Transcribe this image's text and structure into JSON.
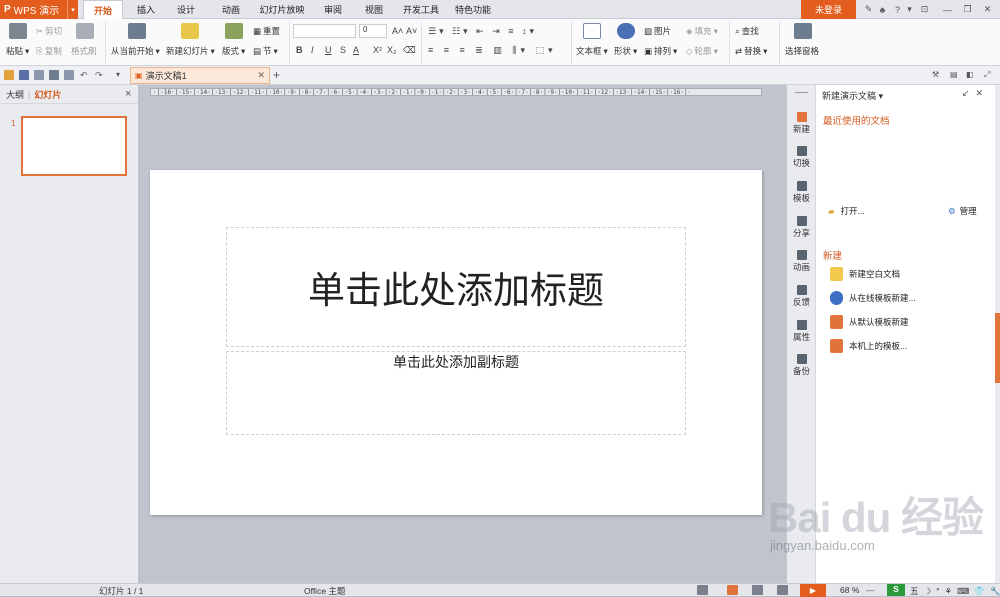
{
  "app": {
    "name": "WPS 演示",
    "drop_icon": "chevron-down-icon",
    "brand_color": "#e25d1e"
  },
  "ribbon_tabs": [
    {
      "label": "开始",
      "active": true
    },
    {
      "label": "插入"
    },
    {
      "label": "设计"
    },
    {
      "label": "动画"
    },
    {
      "label": "幻灯片放映"
    },
    {
      "label": "审阅"
    },
    {
      "label": "视图"
    },
    {
      "label": "开发工具"
    },
    {
      "label": "特色功能"
    }
  ],
  "login": {
    "label": "未登录"
  },
  "titlebar_help": "?",
  "ribbon": {
    "paste": "粘贴",
    "cut": "剪切",
    "copy": "复制",
    "format_painter": "格式刷",
    "from_current": "从当前开始",
    "new_slide": "新建幻灯片",
    "layout": "版式",
    "reset": "重置",
    "section": "节",
    "font_size": "0",
    "text_box": "文本框",
    "shape": "形状",
    "picture": "图片",
    "arrange": "排列",
    "fill": "填充",
    "outline": "轮廓",
    "find": "查找",
    "replace": "替换",
    "selection_pane": "选择窗格"
  },
  "doc_tab": {
    "title": "演示文稿1",
    "add": "+"
  },
  "left_panel": {
    "outline_tab": "大纲",
    "slides_tab": "幻灯片",
    "close": "×",
    "slide_number": "1"
  },
  "ruler_text": "·|·16·|·15·|·14·|·13·|·12·|·11·|·10·|·9·|·8·|·7·|·6·|·5·|·4·|·3·|·2·|·1·|·0·|·1·|·2·|·3·|·4·|·5·|·6·|·7·|·8·|·9·|·10·|·11·|·12·|·13·|·14·|·15·|·16·|·",
  "slide": {
    "title_placeholder": "单击此处添加标题",
    "subtitle_placeholder": "单击此处添加副标题"
  },
  "right_icons": [
    {
      "label": "新建",
      "icon": "new-doc-icon",
      "active": true
    },
    {
      "label": "切换",
      "icon": "switch-icon"
    },
    {
      "label": "模板",
      "icon": "template-icon"
    },
    {
      "label": "分享",
      "icon": "share-icon"
    },
    {
      "label": "动画",
      "icon": "animation-icon"
    },
    {
      "label": "反馈",
      "icon": "feedback-icon"
    },
    {
      "label": "属性",
      "icon": "properties-icon"
    },
    {
      "label": "备份",
      "icon": "backup-icon"
    }
  ],
  "task_pane": {
    "header": "新建演示文稿",
    "recent_heading": "最近使用的文档",
    "open": "打开...",
    "manage": "管理",
    "new_heading": "新建",
    "items": [
      {
        "label": "新建空白文档",
        "icon": "blank-doc-icon",
        "color": "#f2c94c"
      },
      {
        "label": "从在线模板新建...",
        "icon": "online-template-icon",
        "color": "#3a6fc4"
      },
      {
        "label": "从默认模板新建",
        "icon": "default-template-icon",
        "color": "#e0733a"
      },
      {
        "label": "本机上的模板...",
        "icon": "local-template-icon",
        "color": "#e0733a"
      }
    ]
  },
  "statusbar": {
    "slide_count": "幻灯片 1 / 1",
    "theme": "Office 主题",
    "zoom": "68 %"
  },
  "watermark": {
    "brand": "Bai du 经验",
    "url": "jingyan.baidu.com"
  },
  "accent_color": "#e0733a"
}
